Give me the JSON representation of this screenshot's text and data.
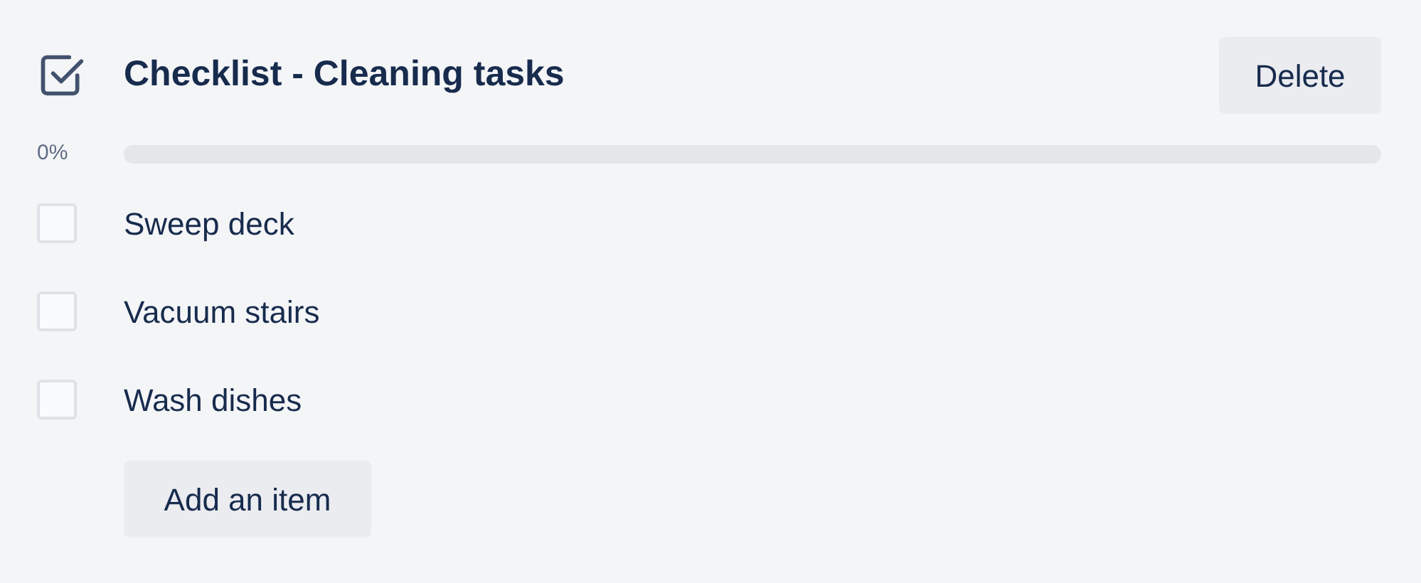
{
  "checklist": {
    "title": "Checklist - Cleaning tasks",
    "delete_button": "Delete",
    "progress": {
      "reading": "0%",
      "level": 0
    },
    "items": [
      {
        "label": "Sweep deck",
        "checked": false
      },
      {
        "label": "Vacuum stairs",
        "checked": false
      },
      {
        "label": "Wash dishes",
        "checked": false
      }
    ],
    "add_button": "Add an item"
  }
}
